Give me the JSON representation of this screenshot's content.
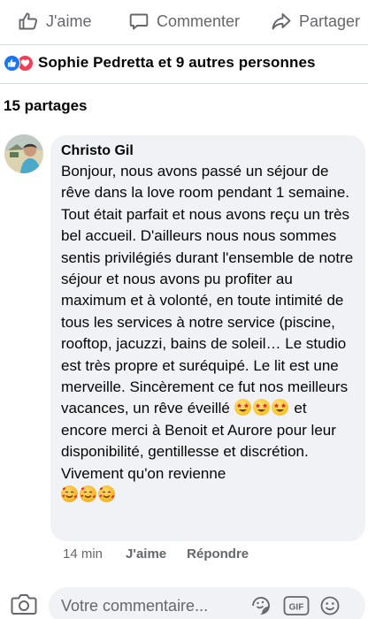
{
  "actions": {
    "like_label": "J'aime",
    "comment_label": "Commenter",
    "share_label": "Partager"
  },
  "reactions": {
    "icons": [
      "like-icon",
      "love-icon"
    ],
    "summary": "Sophie Pedretta et 9 autres personnes"
  },
  "shares": {
    "label": "15 partages"
  },
  "comment": {
    "author": "Christo Gil",
    "text_part1": "Bonjour, nous avons passé un séjour de rêve dans la love room pendant 1 semaine. Tout était parfait et nous avons reçu un très bel accueil. D'ailleurs nous nous sommes sentis privilégiés durant l'ensemble de notre séjour et nous avons pu profiter au maximum et à volonté, en toute intimité de tous les services à notre service (piscine, rooftop, jacuzzi, bains de soleil… Le studio est très propre et suréquipé. Le lit est une merveille. Sincèrement ce fut nos meilleurs vacances, un rêve éveillé",
    "text_part2": "et encore merci à Benoit et Aurore pour leur disponibilité, gentillesse et discrétion. Vivement qu'on revienne",
    "emoji_1": "star-struck-emoji",
    "emoji_2": "smiling-face-with-hearts-emoji",
    "time": "14 min",
    "like_label": "J'aime",
    "reply_label": "Répondre"
  },
  "composer": {
    "placeholder": "Votre commentaire..."
  },
  "colors": {
    "secondary_text": "#65676b",
    "bubble_bg": "#f0f2f5",
    "like_blue": "#1877f2",
    "love_red": "#f33e58"
  }
}
